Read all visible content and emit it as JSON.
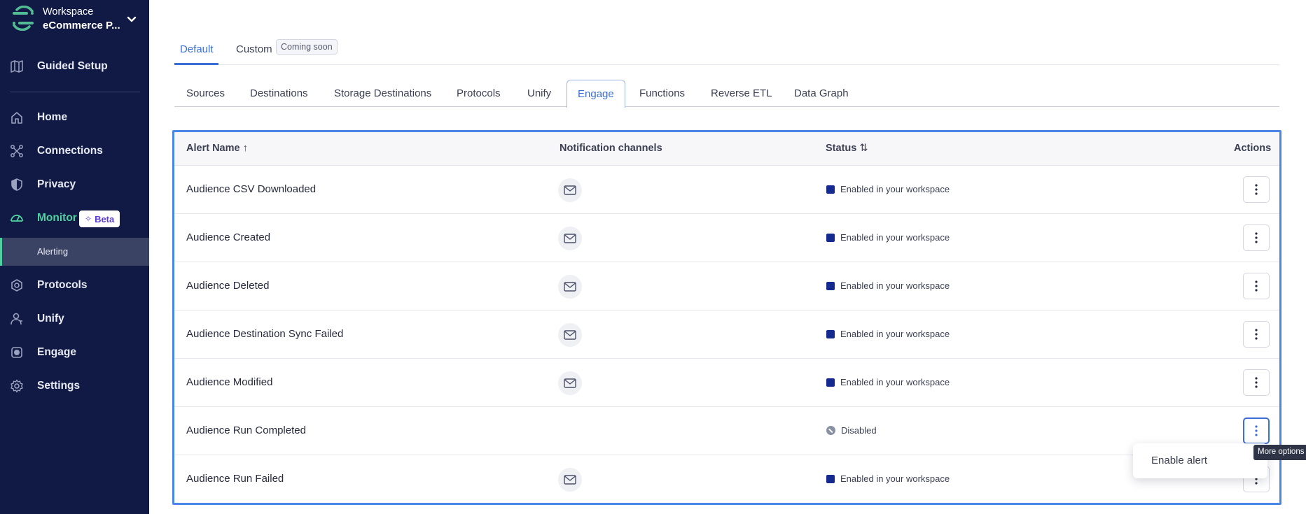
{
  "sidebar": {
    "workspace_label": "Workspace",
    "workspace_name": "eCommerce P...",
    "guided_setup": "Guided Setup",
    "items": [
      {
        "label": "Home",
        "icon": "home-icon"
      },
      {
        "label": "Connections",
        "icon": "connections-icon"
      },
      {
        "label": "Privacy",
        "icon": "shield-icon"
      },
      {
        "label": "Monitor",
        "icon": "gauge-icon"
      },
      {
        "label": "Protocols",
        "icon": "protocols-icon"
      },
      {
        "label": "Unify",
        "icon": "user-icon"
      },
      {
        "label": "Engage",
        "icon": "engage-icon"
      },
      {
        "label": "Settings",
        "icon": "gear-icon"
      }
    ],
    "beta_badge": "Beta",
    "sub_item": "Alerting",
    "accent": "#4fd1a0"
  },
  "top_tabs": {
    "default": "Default",
    "custom": "Custom",
    "coming_soon": "Coming soon"
  },
  "category_tabs": [
    "Sources",
    "Destinations",
    "Storage Destinations",
    "Protocols",
    "Unify",
    "Engage",
    "Functions",
    "Reverse ETL",
    "Data Graph"
  ],
  "active_category": "Engage",
  "table": {
    "headers": {
      "name": "Alert Name",
      "channels": "Notification channels",
      "status": "Status",
      "actions": "Actions"
    },
    "rows": [
      {
        "name": "Audience CSV Downloaded",
        "email": true,
        "status": "Enabled in your workspace"
      },
      {
        "name": "Audience Created",
        "email": true,
        "status": "Enabled in your workspace"
      },
      {
        "name": "Audience Deleted",
        "email": true,
        "status": "Enabled in your workspace"
      },
      {
        "name": "Audience Destination Sync Failed",
        "email": true,
        "status": "Enabled in your workspace"
      },
      {
        "name": "Audience Modified",
        "email": true,
        "status": "Enabled in your workspace"
      },
      {
        "name": "Audience Run Completed",
        "email": false,
        "status": "Disabled"
      },
      {
        "name": "Audience Run Failed",
        "email": true,
        "status": "Enabled in your workspace"
      }
    ]
  },
  "menu": {
    "enable_alert": "Enable alert"
  },
  "tooltip": "More options",
  "colors": {
    "active_tab": "#3c6ed8",
    "enabled_status": "#142a8f",
    "sidebar_bg": "#101a44"
  }
}
